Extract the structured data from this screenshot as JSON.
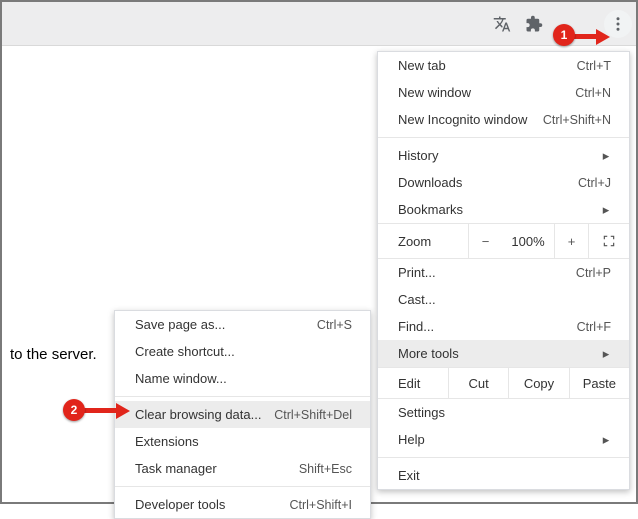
{
  "toolbar": {
    "translate_icon": "translate-icon",
    "extensions_icon": "puzzle-icon",
    "menu_icon": "vertical-dots-icon"
  },
  "page_text": "to the server.",
  "menu": {
    "new_tab": {
      "label": "New tab",
      "shortcut": "Ctrl+T"
    },
    "new_window": {
      "label": "New window",
      "shortcut": "Ctrl+N"
    },
    "new_incognito": {
      "label": "New Incognito window",
      "shortcut": "Ctrl+Shift+N"
    },
    "history": {
      "label": "History"
    },
    "downloads": {
      "label": "Downloads",
      "shortcut": "Ctrl+J"
    },
    "bookmarks": {
      "label": "Bookmarks"
    },
    "zoom": {
      "label": "Zoom",
      "minus": "−",
      "pct": "100%",
      "plus": "+"
    },
    "print": {
      "label": "Print...",
      "shortcut": "Ctrl+P"
    },
    "cast": {
      "label": "Cast..."
    },
    "find": {
      "label": "Find...",
      "shortcut": "Ctrl+F"
    },
    "more_tools": {
      "label": "More tools"
    },
    "edit": {
      "label": "Edit",
      "cut": "Cut",
      "copy": "Copy",
      "paste": "Paste"
    },
    "settings": {
      "label": "Settings"
    },
    "help": {
      "label": "Help"
    },
    "exit": {
      "label": "Exit"
    }
  },
  "submenu": {
    "save_page": {
      "label": "Save page as...",
      "shortcut": "Ctrl+S"
    },
    "create_shortcut": {
      "label": "Create shortcut..."
    },
    "name_window": {
      "label": "Name window..."
    },
    "clear_browsing": {
      "label": "Clear browsing data...",
      "shortcut": "Ctrl+Shift+Del"
    },
    "extensions": {
      "label": "Extensions"
    },
    "task_manager": {
      "label": "Task manager",
      "shortcut": "Shift+Esc"
    },
    "devtools": {
      "label": "Developer tools",
      "shortcut": "Ctrl+Shift+I"
    }
  },
  "annotations": {
    "badge1": "1",
    "badge2": "2"
  }
}
